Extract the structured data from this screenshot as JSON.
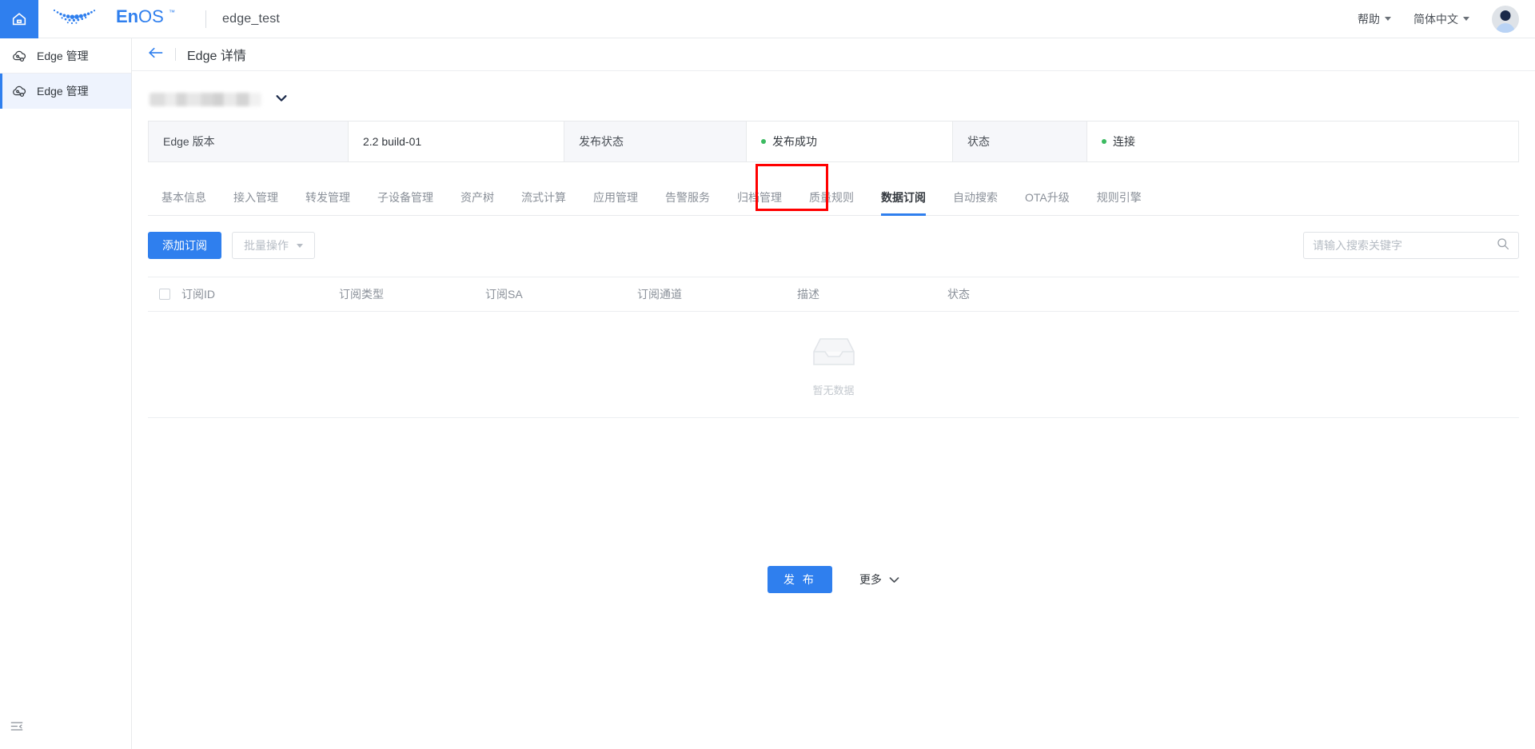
{
  "topbar": {
    "home_icon": "home-icon",
    "brand": "EnOS",
    "brand_tm": "™",
    "project_name": "edge_test",
    "help_label": "帮助",
    "lang_label": "简体中文",
    "avatar_icon": "user-avatar-icon"
  },
  "sidebar": {
    "items": [
      {
        "label": "Edge 管理",
        "icon": "edge-cloud-icon",
        "active": false
      },
      {
        "label": "Edge 管理",
        "icon": "edge-cloud-icon",
        "active": true
      }
    ],
    "collapse_icon": "collapse-menu-icon"
  },
  "page": {
    "back_icon": "back-arrow-icon",
    "title": "Edge 详情",
    "device_name_redacted": "",
    "device_dropdown_icon": "chevron-down-icon"
  },
  "info_strip": [
    {
      "label": "Edge 版本",
      "value": "2.2 build-01",
      "status": false
    },
    {
      "label": "发布状态",
      "value": "发布成功",
      "status": true,
      "status_color": "#3cbb61"
    },
    {
      "label": "状态",
      "value": "连接",
      "status": true,
      "status_color": "#3cbb61"
    }
  ],
  "tabs": [
    {
      "label": "基本信息",
      "active": false
    },
    {
      "label": "接入管理",
      "active": false
    },
    {
      "label": "转发管理",
      "active": false
    },
    {
      "label": "子设备管理",
      "active": false
    },
    {
      "label": "资产树",
      "active": false
    },
    {
      "label": "流式计算",
      "active": false
    },
    {
      "label": "应用管理",
      "active": false
    },
    {
      "label": "告警服务",
      "active": false
    },
    {
      "label": "归档管理",
      "active": false
    },
    {
      "label": "质量规则",
      "active": false
    },
    {
      "label": "数据订阅",
      "active": true
    },
    {
      "label": "自动搜索",
      "active": false
    },
    {
      "label": "OTA升级",
      "active": false
    },
    {
      "label": "规则引擎",
      "active": false
    }
  ],
  "highlight_color": "#ff0000",
  "accent_color": "#2f7fee",
  "toolbar": {
    "add_label": "添加订阅",
    "batch_label": "批量操作",
    "batch_caret_icon": "chevron-down-icon",
    "search_placeholder": "请输入搜索关键字",
    "search_value": "",
    "search_icon": "search-icon"
  },
  "table": {
    "select_all_checkbox": "select-all-checkbox",
    "columns": [
      "订阅ID",
      "订阅类型",
      "订阅SA",
      "订阅通道",
      "描述",
      "状态"
    ],
    "rows": [],
    "empty_text": "暂无数据",
    "empty_icon": "empty-box-icon"
  },
  "footer": {
    "publish_label": "发 布",
    "more_label": "更多",
    "more_caret_icon": "chevron-down-icon"
  }
}
